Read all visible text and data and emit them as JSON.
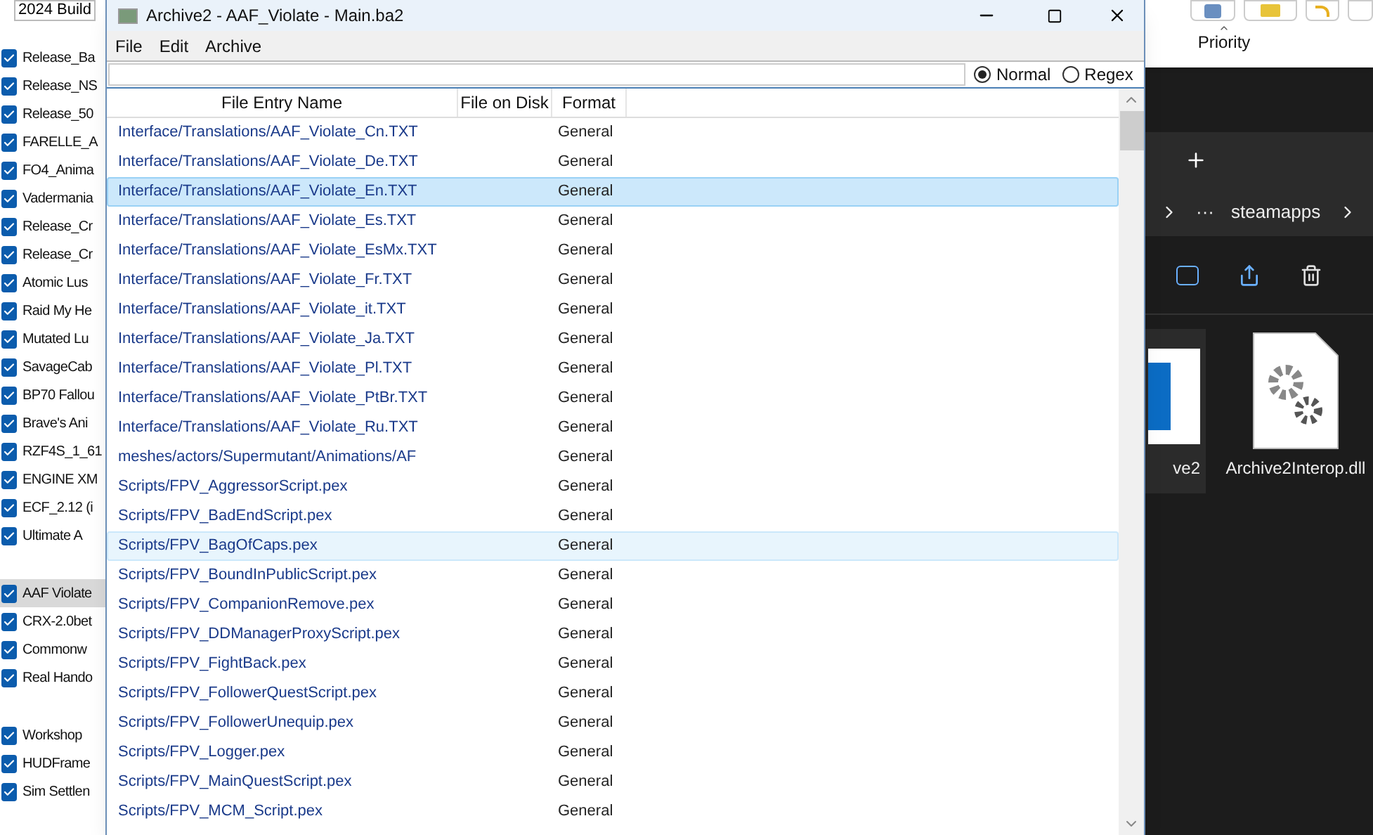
{
  "left_panel": {
    "build_selector": "2024 Build",
    "groups": [
      [
        {
          "label": "Release_Ba",
          "checked": true,
          "selected": false
        },
        {
          "label": "Release_NS",
          "checked": true,
          "selected": false
        },
        {
          "label": "Release_50",
          "checked": true,
          "selected": false
        },
        {
          "label": "FARELLE_A",
          "checked": true,
          "selected": false
        },
        {
          "label": "FO4_Anima",
          "checked": true,
          "selected": false
        },
        {
          "label": "Vadermania",
          "checked": true,
          "selected": false
        },
        {
          "label": "Release_Cr",
          "checked": true,
          "selected": false
        },
        {
          "label": "Release_Cr",
          "checked": true,
          "selected": false
        },
        {
          "label": "Atomic Lus",
          "checked": true,
          "selected": false
        },
        {
          "label": "Raid My He",
          "checked": true,
          "selected": false
        },
        {
          "label": "Mutated Lu",
          "checked": true,
          "selected": false
        },
        {
          "label": "SavageCab",
          "checked": true,
          "selected": false
        },
        {
          "label": "BP70 Fallou",
          "checked": true,
          "selected": false
        },
        {
          "label": "Brave's Ani",
          "checked": true,
          "selected": false
        },
        {
          "label": "RZF4S_1_61",
          "checked": true,
          "selected": false
        },
        {
          "label": "ENGINE XM",
          "checked": true,
          "selected": false
        },
        {
          "label": "ECF_2.12 (i",
          "checked": true,
          "selected": false
        },
        {
          "label": "Ultimate A",
          "checked": true,
          "selected": false
        }
      ],
      [
        {
          "label": "AAF Violate",
          "checked": true,
          "selected": true
        },
        {
          "label": "CRX-2.0bet",
          "checked": true,
          "selected": false
        },
        {
          "label": "Commonw",
          "checked": true,
          "selected": false
        },
        {
          "label": "Real Hando",
          "checked": true,
          "selected": false
        }
      ],
      [
        {
          "label": "Workshop",
          "checked": true,
          "selected": false
        },
        {
          "label": "HUDFrame",
          "checked": true,
          "selected": false
        },
        {
          "label": "Sim Settlen",
          "checked": true,
          "selected": false
        }
      ]
    ]
  },
  "window": {
    "title": "Archive2 - AAF_Violate - Main.ba2",
    "menu": [
      "File",
      "Edit",
      "Archive"
    ],
    "search": {
      "modes": [
        {
          "label": "Normal",
          "selected": true
        },
        {
          "label": "Regex",
          "selected": false
        }
      ]
    },
    "table": {
      "columns": [
        "File Entry Name",
        "File on Disk",
        "Format"
      ],
      "rows": [
        {
          "name": "Interface/Translations/AAF_Violate_Cn.TXT",
          "format": "General",
          "selected": false,
          "hover": false
        },
        {
          "name": "Interface/Translations/AAF_Violate_De.TXT",
          "format": "General",
          "selected": false,
          "hover": false
        },
        {
          "name": "Interface/Translations/AAF_Violate_En.TXT",
          "format": "General",
          "selected": true,
          "hover": false
        },
        {
          "name": "Interface/Translations/AAF_Violate_Es.TXT",
          "format": "General",
          "selected": false,
          "hover": false
        },
        {
          "name": "Interface/Translations/AAF_Violate_EsMx.TXT",
          "format": "General",
          "selected": false,
          "hover": false
        },
        {
          "name": "Interface/Translations/AAF_Violate_Fr.TXT",
          "format": "General",
          "selected": false,
          "hover": false
        },
        {
          "name": "Interface/Translations/AAF_Violate_it.TXT",
          "format": "General",
          "selected": false,
          "hover": false
        },
        {
          "name": "Interface/Translations/AAF_Violate_Ja.TXT",
          "format": "General",
          "selected": false,
          "hover": false
        },
        {
          "name": "Interface/Translations/AAF_Violate_Pl.TXT",
          "format": "General",
          "selected": false,
          "hover": false
        },
        {
          "name": "Interface/Translations/AAF_Violate_PtBr.TXT",
          "format": "General",
          "selected": false,
          "hover": false
        },
        {
          "name": "Interface/Translations/AAF_Violate_Ru.TXT",
          "format": "General",
          "selected": false,
          "hover": false
        },
        {
          "name": "meshes/actors/Supermutant/Animations/AF",
          "format": "General",
          "selected": false,
          "hover": false
        },
        {
          "name": "Scripts/FPV_AggressorScript.pex",
          "format": "General",
          "selected": false,
          "hover": false
        },
        {
          "name": "Scripts/FPV_BadEndScript.pex",
          "format": "General",
          "selected": false,
          "hover": false
        },
        {
          "name": "Scripts/FPV_BagOfCaps.pex",
          "format": "General",
          "selected": false,
          "hover": true
        },
        {
          "name": "Scripts/FPV_BoundInPublicScript.pex",
          "format": "General",
          "selected": false,
          "hover": false
        },
        {
          "name": "Scripts/FPV_CompanionRemove.pex",
          "format": "General",
          "selected": false,
          "hover": false
        },
        {
          "name": "Scripts/FPV_DDManagerProxyScript.pex",
          "format": "General",
          "selected": false,
          "hover": false
        },
        {
          "name": "Scripts/FPV_FightBack.pex",
          "format": "General",
          "selected": false,
          "hover": false
        },
        {
          "name": "Scripts/FPV_FollowerQuestScript.pex",
          "format": "General",
          "selected": false,
          "hover": false
        },
        {
          "name": "Scripts/FPV_FollowerUnequip.pex",
          "format": "General",
          "selected": false,
          "hover": false
        },
        {
          "name": "Scripts/FPV_Logger.pex",
          "format": "General",
          "selected": false,
          "hover": false
        },
        {
          "name": "Scripts/FPV_MainQuestScript.pex",
          "format": "General",
          "selected": false,
          "hover": false
        },
        {
          "name": "Scripts/FPV_MCM_Script.pex",
          "format": "General",
          "selected": false,
          "hover": false
        }
      ]
    }
  },
  "right_panel": {
    "column_header": "Priority",
    "breadcrumb": [
      "···",
      "steamapps"
    ],
    "files": [
      {
        "label": "ve2",
        "kind": "app"
      },
      {
        "label": "Archive2Interop.dll",
        "kind": "dll"
      }
    ]
  }
}
